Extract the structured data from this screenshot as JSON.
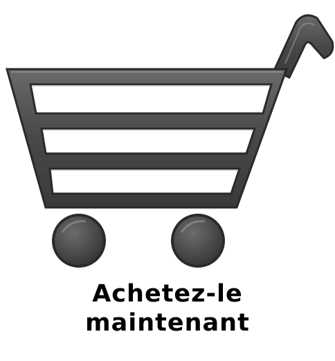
{
  "icon": "shopping-cart-icon",
  "caption": {
    "line1": "Achetez-le",
    "line2": "maintenant"
  },
  "colors": {
    "cart_body": "#4a4a4a",
    "cart_outline": "#2a2a2a",
    "cart_highlight": "#9a9a9a",
    "background": "#ffffff",
    "text": "#000000"
  }
}
